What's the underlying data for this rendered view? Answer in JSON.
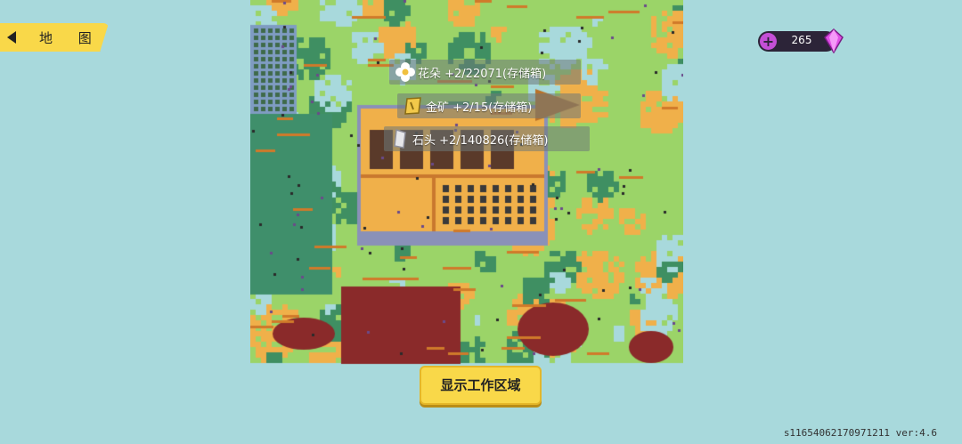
{
  "nav": {
    "map_label": "地 图"
  },
  "currency": {
    "gems": "265",
    "gem_color": "#e04fe6",
    "icons": [
      "plus-icon",
      "gem-icon"
    ]
  },
  "resources": [
    {
      "icon": "flower-icon",
      "text": "花朵 +2/22071(存储箱)"
    },
    {
      "icon": "gold-ore-icon",
      "text": "金矿 +2/15(存储箱)"
    },
    {
      "icon": "stone-icon",
      "text": "石头 +2/140826(存储箱)"
    }
  ],
  "work_area_button": "显示工作区域",
  "version_text": "s11654062170971211 ver:4.6",
  "colors": {
    "background": "#a8d9dc",
    "grass_light": "#9bd468",
    "grass_dark": "#3f8f62",
    "sand": "#f0b04a",
    "mud": "#8a2a2a",
    "button_yellow": "#f9d849"
  }
}
